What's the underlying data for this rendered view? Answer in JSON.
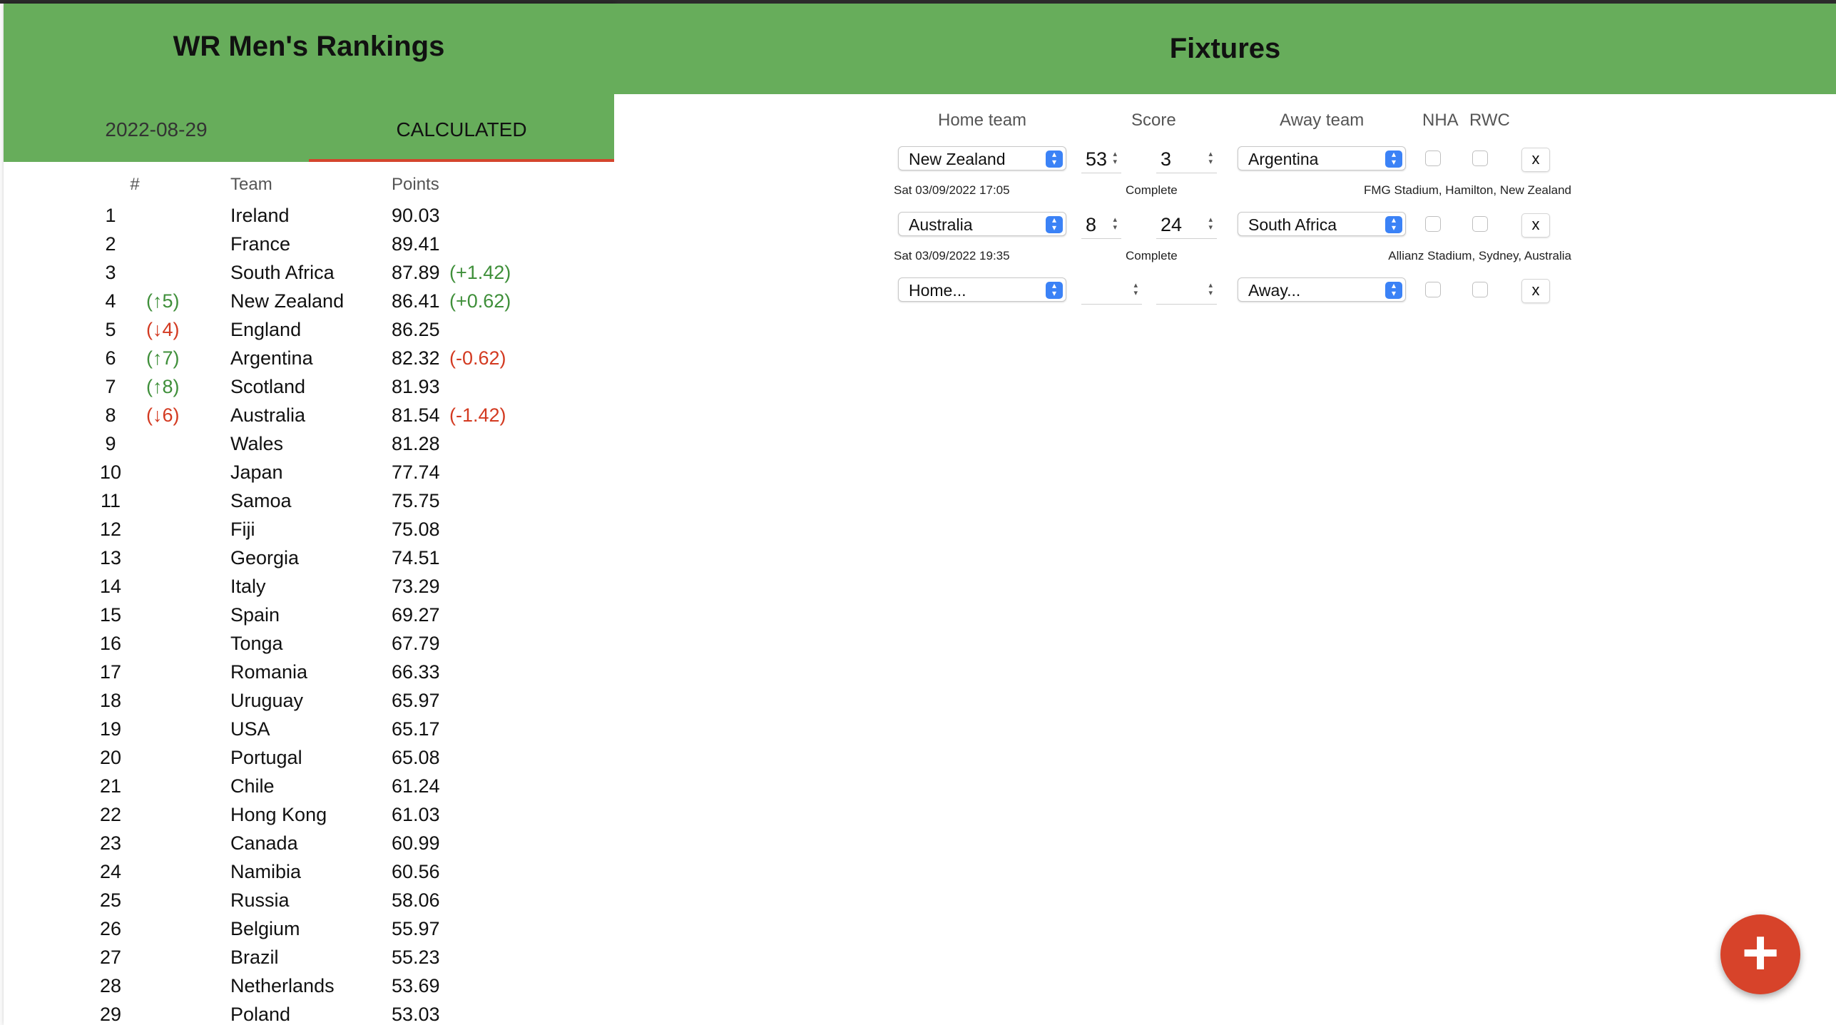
{
  "rankings": {
    "title": "WR Men's Rankings",
    "tabs": [
      "2022-08-29",
      "CALCULATED"
    ],
    "columns": {
      "num": "#",
      "team": "Team",
      "points": "Points"
    },
    "rows": [
      {
        "pos": "1",
        "move": "",
        "team": "Ireland",
        "points": "90.03",
        "delta": ""
      },
      {
        "pos": "2",
        "move": "",
        "team": "France",
        "points": "89.41",
        "delta": ""
      },
      {
        "pos": "3",
        "move": "",
        "team": "South Africa",
        "points": "87.89",
        "delta": "(+1.42)"
      },
      {
        "pos": "4",
        "move": "(↑5)",
        "team": "New Zealand",
        "points": "86.41",
        "delta": "(+0.62)"
      },
      {
        "pos": "5",
        "move": "(↓4)",
        "team": "England",
        "points": "86.25",
        "delta": ""
      },
      {
        "pos": "6",
        "move": "(↑7)",
        "team": "Argentina",
        "points": "82.32",
        "delta": "(-0.62)"
      },
      {
        "pos": "7",
        "move": "(↑8)",
        "team": "Scotland",
        "points": "81.93",
        "delta": ""
      },
      {
        "pos": "8",
        "move": "(↓6)",
        "team": "Australia",
        "points": "81.54",
        "delta": "(-1.42)"
      },
      {
        "pos": "9",
        "move": "",
        "team": "Wales",
        "points": "81.28",
        "delta": ""
      },
      {
        "pos": "10",
        "move": "",
        "team": "Japan",
        "points": "77.74",
        "delta": ""
      },
      {
        "pos": "11",
        "move": "",
        "team": "Samoa",
        "points": "75.75",
        "delta": ""
      },
      {
        "pos": "12",
        "move": "",
        "team": "Fiji",
        "points": "75.08",
        "delta": ""
      },
      {
        "pos": "13",
        "move": "",
        "team": "Georgia",
        "points": "74.51",
        "delta": ""
      },
      {
        "pos": "14",
        "move": "",
        "team": "Italy",
        "points": "73.29",
        "delta": ""
      },
      {
        "pos": "15",
        "move": "",
        "team": "Spain",
        "points": "69.27",
        "delta": ""
      },
      {
        "pos": "16",
        "move": "",
        "team": "Tonga",
        "points": "67.79",
        "delta": ""
      },
      {
        "pos": "17",
        "move": "",
        "team": "Romania",
        "points": "66.33",
        "delta": ""
      },
      {
        "pos": "18",
        "move": "",
        "team": "Uruguay",
        "points": "65.97",
        "delta": ""
      },
      {
        "pos": "19",
        "move": "",
        "team": "USA",
        "points": "65.17",
        "delta": ""
      },
      {
        "pos": "20",
        "move": "",
        "team": "Portugal",
        "points": "65.08",
        "delta": ""
      },
      {
        "pos": "21",
        "move": "",
        "team": "Chile",
        "points": "61.24",
        "delta": ""
      },
      {
        "pos": "22",
        "move": "",
        "team": "Hong Kong",
        "points": "61.03",
        "delta": ""
      },
      {
        "pos": "23",
        "move": "",
        "team": "Canada",
        "points": "60.99",
        "delta": ""
      },
      {
        "pos": "24",
        "move": "",
        "team": "Namibia",
        "points": "60.56",
        "delta": ""
      },
      {
        "pos": "25",
        "move": "",
        "team": "Russia",
        "points": "58.06",
        "delta": ""
      },
      {
        "pos": "26",
        "move": "",
        "team": "Belgium",
        "points": "55.97",
        "delta": ""
      },
      {
        "pos": "27",
        "move": "",
        "team": "Brazil",
        "points": "55.23",
        "delta": ""
      },
      {
        "pos": "28",
        "move": "",
        "team": "Netherlands",
        "points": "53.69",
        "delta": ""
      },
      {
        "pos": "29",
        "move": "",
        "team": "Poland",
        "points": "53.03",
        "delta": ""
      }
    ]
  },
  "fixtures": {
    "title": "Fixtures",
    "columns": {
      "home": "Home team",
      "score": "Score",
      "away": "Away team",
      "nha": "NHA",
      "rwc": "RWC"
    },
    "rows": [
      {
        "home": "New Zealand",
        "home_score": "53",
        "away_score": "3",
        "away": "Argentina",
        "datetime": "Sat 03/09/2022 17:05",
        "status": "Complete",
        "venue": "FMG Stadium, Hamilton, New Zealand",
        "remove": "x"
      },
      {
        "home": "Australia",
        "home_score": "8",
        "away_score": "24",
        "away": "South Africa",
        "datetime": "Sat 03/09/2022 19:35",
        "status": "Complete",
        "venue": "Allianz Stadium, Sydney, Australia",
        "remove": "x"
      }
    ],
    "new_row": {
      "home_placeholder": "Home...",
      "away_placeholder": "Away...",
      "remove": "x"
    },
    "add_button": "+"
  }
}
